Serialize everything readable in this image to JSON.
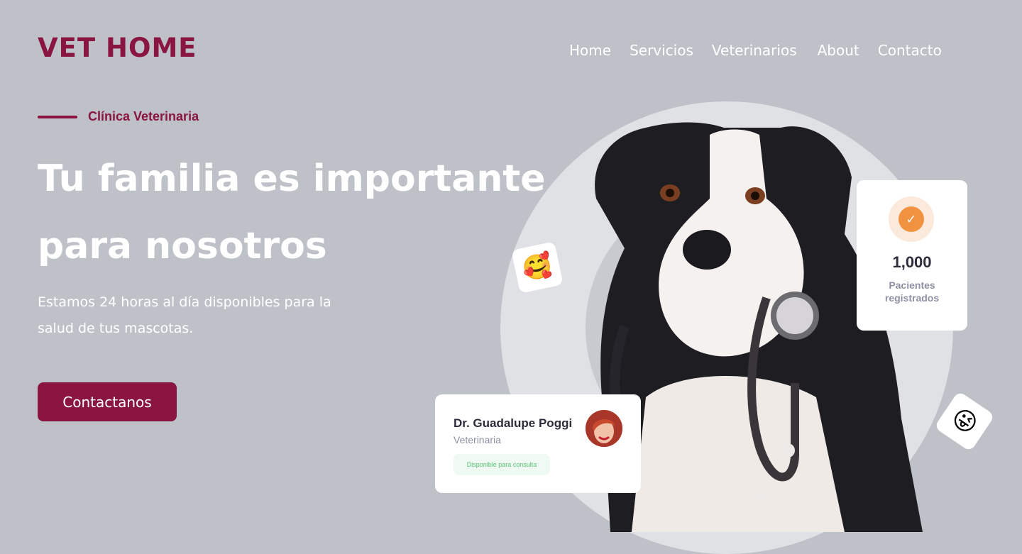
{
  "brand": {
    "logo": "VET HOME"
  },
  "nav": {
    "items": [
      "Home",
      "Servicios",
      "Veterinarios",
      "About",
      "Contacto"
    ]
  },
  "hero": {
    "eyebrow": "Clínica Veterinaria",
    "headline_line1": "Tu familia es importante",
    "headline_line2": "para nosotros",
    "subtext": "Estamos 24 horas al día disponibles para la salud de tus mascotas.",
    "cta_label": "Contactanos"
  },
  "stats_card": {
    "value": "1,000",
    "label": "Pacientes registrados",
    "icon": "check-icon"
  },
  "doctor_card": {
    "name": "Dr. Guadalupe Poggi",
    "role": "Veterinaria",
    "status": "Disponible para consulta"
  },
  "emojis": {
    "first": "🥰",
    "second": "😜"
  },
  "colors": {
    "brand": "#891540",
    "background": "#bfc1c9",
    "accent_orange": "#f0923f",
    "status_green": "#5bbf76"
  }
}
